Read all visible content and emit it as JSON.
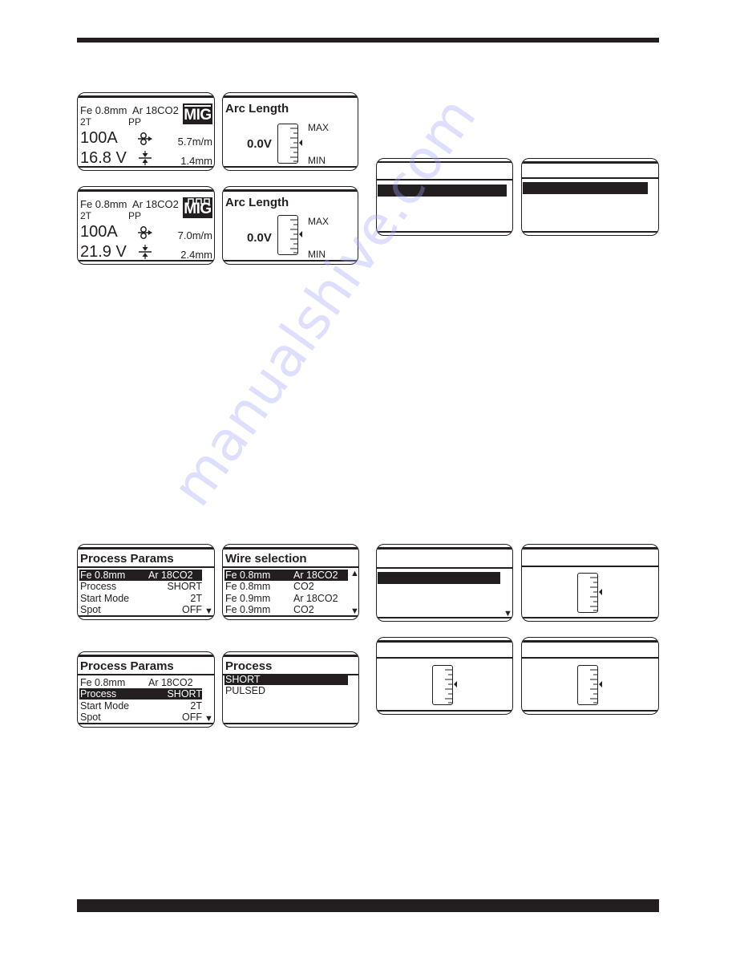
{
  "home_screens": [
    {
      "wire": "Fe 0.8mm",
      "gas": "Ar 18CO2",
      "trigger_mode": "2T",
      "pulse_mode": "PP",
      "current": "100A",
      "voltage": "16.8 V",
      "wire_feed_speed": "5.7m/m",
      "stickout": "1.4mm",
      "process_badge": "MIG",
      "process_icon": "mig-short-icon"
    },
    {
      "wire": "Fe 0.8mm",
      "gas": "Ar 18CO2",
      "trigger_mode": "2T",
      "pulse_mode": "PP",
      "current": "100A",
      "voltage": "21.9 V",
      "wire_feed_speed": "7.0m/m",
      "stickout": "2.4mm",
      "process_badge": "MIG",
      "process_icon": "mig-pulse-icon"
    }
  ],
  "arc_screens": [
    {
      "title": "Arc Length",
      "value": "0.0V",
      "max_label": "MAX",
      "min_label": "MIN"
    },
    {
      "title": "Arc Length",
      "value": "0.0V",
      "max_label": "MAX",
      "min_label": "MIN"
    }
  ],
  "process_params_1": {
    "title": "Process Params",
    "rows": [
      {
        "key": "Fe 0.8mm",
        "value": "Ar 18CO2",
        "selected": true
      },
      {
        "key": "Process",
        "value": "SHORT",
        "selected": false
      },
      {
        "key": "Start Mode",
        "value": "2T",
        "selected": false
      },
      {
        "key": "Spot",
        "value": "OFF",
        "selected": false
      }
    ],
    "scroll_down": "▼"
  },
  "wire_selection": {
    "title": "Wire selection",
    "rows": [
      {
        "key": "Fe 0.8mm",
        "value": "Ar 18CO2",
        "selected": true
      },
      {
        "key": "Fe 0.8mm",
        "value": "CO2",
        "selected": false
      },
      {
        "key": "Fe 0.9mm",
        "value": "Ar 18CO2",
        "selected": false
      },
      {
        "key": "Fe 0.9mm",
        "value": "CO2",
        "selected": false
      }
    ],
    "scroll_up": "▲",
    "scroll_down": "▼"
  },
  "process_params_2": {
    "title": "Process Params",
    "rows": [
      {
        "key": "Fe 0.8mm",
        "value": "Ar 18CO2",
        "selected": false
      },
      {
        "key": "Process",
        "value": "SHORT",
        "selected": true
      },
      {
        "key": "Start Mode",
        "value": "2T",
        "selected": false
      },
      {
        "key": "Spot",
        "value": "OFF",
        "selected": false
      }
    ],
    "scroll_down": "▼"
  },
  "process_select": {
    "title": "Process",
    "options": [
      {
        "label": "SHORT",
        "selected": true
      },
      {
        "label": "PULSED",
        "selected": false
      }
    ]
  },
  "blank_screens": {
    "scroll_down": "▼"
  },
  "watermark": "manualshive.com"
}
